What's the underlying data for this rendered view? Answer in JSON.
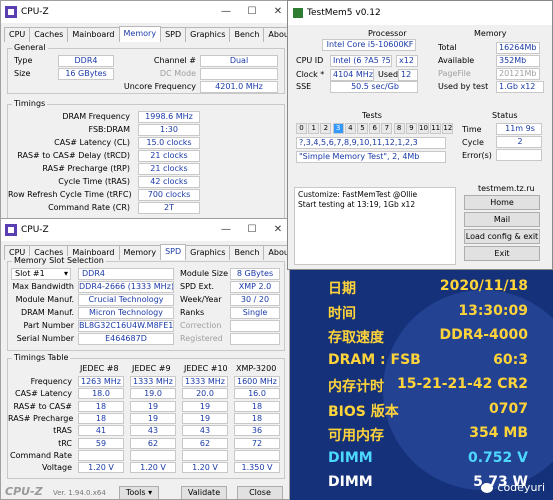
{
  "cpuz1": {
    "title": "CPU-Z",
    "tabs": [
      "CPU",
      "Caches",
      "Mainboard",
      "Memory",
      "SPD",
      "Graphics",
      "Bench",
      "About"
    ],
    "general": {
      "title": "General",
      "type_label": "Type",
      "type": "DDR4",
      "size_label": "Size",
      "size": "16 GBytes",
      "channel_label": "Channel #",
      "channel": "Dual",
      "dcmode_label": "DC Mode",
      "uncore_label": "Uncore Frequency",
      "uncore": "4201.0 MHz"
    },
    "timings": {
      "title": "Timings",
      "rows": [
        {
          "label": "DRAM Frequency",
          "value": "1998.6 MHz"
        },
        {
          "label": "FSB:DRAM",
          "value": "1:30"
        },
        {
          "label": "CAS# Latency (CL)",
          "value": "15.0 clocks"
        },
        {
          "label": "RAS# to CAS# Delay (tRCD)",
          "value": "21 clocks"
        },
        {
          "label": "RAS# Precharge (tRP)",
          "value": "21 clocks"
        },
        {
          "label": "Cycle Time (tRAS)",
          "value": "42 clocks"
        },
        {
          "label": "Row Refresh Cycle Time (tRFC)",
          "value": "700 clocks"
        },
        {
          "label": "Command Rate (CR)",
          "value": "2T"
        }
      ]
    }
  },
  "cpuz2": {
    "title": "CPU-Z",
    "tabs": [
      "CPU",
      "Caches",
      "Mainboard",
      "Memory",
      "SPD",
      "Graphics",
      "Bench",
      "About"
    ],
    "slot": {
      "title": "Memory Slot Selection",
      "slot": "Slot #1",
      "type": "DDR4",
      "module_size_label": "Module Size",
      "module_size": "8 GBytes",
      "max_bw_label": "Max Bandwidth",
      "max_bw": "DDR4-2666 (1333 MHz)",
      "spd_ext_label": "SPD Ext.",
      "spd_ext": "XMP 2.0",
      "manuf_label": "Module Manuf.",
      "manuf": "Crucial Technology",
      "week_label": "Week/Year",
      "week": "30 / 20",
      "dram_manuf_label": "DRAM Manuf.",
      "dram_manuf": "Micron Technology",
      "ranks_label": "Ranks",
      "ranks": "Single",
      "part_label": "Part Number",
      "part": "BL8G32C16U4W.M8FE1",
      "correction_label": "Correction",
      "serial_label": "Serial Number",
      "serial": "E464687D",
      "registered_label": "Registered"
    },
    "timings_table": {
      "title": "Timings Table",
      "headers": [
        "JEDEC #8",
        "JEDEC #9",
        "JEDEC #10",
        "XMP-3200"
      ],
      "rows": [
        {
          "label": "Frequency",
          "values": [
            "1263 MHz",
            "1333 MHz",
            "1333 MHz",
            "1600 MHz"
          ]
        },
        {
          "label": "CAS# Latency",
          "values": [
            "18.0",
            "19.0",
            "20.0",
            "16.0"
          ]
        },
        {
          "label": "RAS# to CAS#",
          "values": [
            "18",
            "19",
            "19",
            "18"
          ]
        },
        {
          "label": "RAS# Precharge",
          "values": [
            "18",
            "19",
            "19",
            "18"
          ]
        },
        {
          "label": "tRAS",
          "values": [
            "41",
            "43",
            "43",
            "36"
          ]
        },
        {
          "label": "tRC",
          "values": [
            "59",
            "62",
            "62",
            "72"
          ]
        },
        {
          "label": "Command Rate",
          "values": [
            "",
            "",
            "",
            ""
          ]
        },
        {
          "label": "Voltage",
          "values": [
            "1.20 V",
            "1.20 V",
            "1.20 V",
            "1.350 V"
          ]
        }
      ]
    },
    "footer": {
      "brand": "CPU-Z",
      "version": "Ver. 1.94.0.x64",
      "tools": "Tools",
      "validate": "Validate",
      "close": "Close"
    }
  },
  "testmem": {
    "title": "TestMem5 v0.12",
    "processor": {
      "title": "Processor",
      "name": "Intel Core i5-10600KF",
      "cpuid_label": "CPU ID",
      "cpuid": "Intel (6 ?A5 ?5)",
      "threads": "x12",
      "clock_label": "Clock *",
      "clock": "4104 MHz",
      "used_label": "Used",
      "used": "12",
      "sse_label": "SSE",
      "sse": "50.5 sec/Gb"
    },
    "memory": {
      "title": "Memory",
      "total_label": "Total",
      "total": "16264Mb",
      "avail_label": "Available",
      "avail": "352Mb",
      "pagefile_label": "PageFile",
      "pagefile": "20121Mb",
      "usedtest_label": "Used by test",
      "usedtest": "1.Gb x12"
    },
    "tests": {
      "title": "Tests",
      "cells": [
        "0",
        "1",
        "2",
        "3",
        "4",
        "5",
        "6",
        "7",
        "8",
        "9",
        "10",
        "11",
        "12"
      ],
      "active": "3",
      "sequence": "?,3,4,5,6,7,8,9,10,11,12,1,2,3",
      "config": "\"Simple Memory Test\", 2, 4Mb"
    },
    "status": {
      "title": "Status",
      "time_label": "Time",
      "time": "11m 9s",
      "cycle_label": "Cycle",
      "cycle": "2",
      "errors_label": "Error(s)",
      "errors": ""
    },
    "log": [
      "Customize: FastMemTest @Ollie",
      "Start testing at 13:19, 1Gb x12"
    ],
    "site": "testmem.tz.ru",
    "buttons": [
      "Home",
      "Mail",
      "Load config & exit",
      "Exit"
    ]
  },
  "bios": {
    "rows": [
      {
        "k": "日期",
        "v": "2020/11/18"
      },
      {
        "k": "时间",
        "v": "13:30:09"
      },
      {
        "k": "存取速度",
        "v": "DDR4-4000"
      },
      {
        "k": "DRAM : FSB",
        "v": "60:3"
      },
      {
        "k": "内存计时",
        "v": "15-21-21-42 CR2"
      },
      {
        "k": "BIOS 版本",
        "v": "0707"
      },
      {
        "k": "可用内存",
        "v": "354 MB"
      },
      {
        "k": "DIMM",
        "v": "0.752 V"
      },
      {
        "k": "DIMM",
        "v": "5.73 W"
      }
    ],
    "watermark": "codeyuri"
  },
  "colors": {
    "value_blue": "#1a3aa8",
    "bios_bg": "#14317a",
    "bios_yellow": "#ffd43a",
    "bios_cyan": "#4dd8ff",
    "test_active": "#3399ff"
  }
}
